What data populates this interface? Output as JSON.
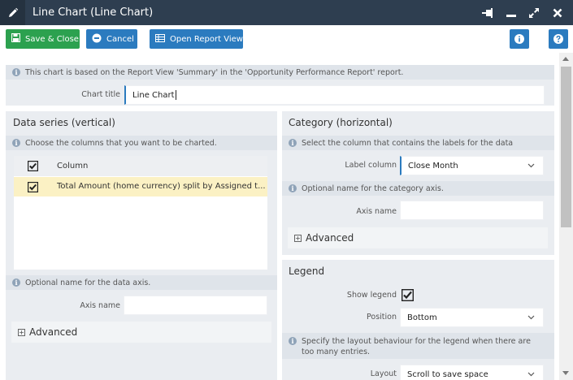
{
  "window": {
    "title": "Line Chart (Line Chart)",
    "icons": [
      "pencil-icon",
      "pin-icon",
      "minimize-icon",
      "maximize-icon",
      "close-icon"
    ]
  },
  "toolbar": {
    "save_close": "Save & Close",
    "cancel": "Cancel",
    "open_report_view": "Open Report View",
    "info_icon": "info-icon",
    "help_icon": "help-icon"
  },
  "intro": {
    "info": "This chart is based on the Report View 'Summary' in the 'Opportunity Performance Report' report.",
    "chart_title_label": "Chart title",
    "chart_title_value": "Line Chart"
  },
  "data_series": {
    "heading": "Data series (vertical)",
    "info": "Choose the columns that you want to be charted.",
    "column_header": "Column",
    "rows": [
      {
        "label": "Total Amount (home currency) split by Assigned t...",
        "checked": true
      }
    ],
    "axis_info": "Optional name for the data axis.",
    "axis_name_label": "Axis name",
    "axis_name_value": "",
    "advanced": "Advanced"
  },
  "category": {
    "heading": "Category (horizontal)",
    "info": "Select the column that contains the labels for the data",
    "label_column_label": "Label column",
    "label_column_value": "Close Month",
    "axis_info": "Optional name for the category axis.",
    "axis_name_label": "Axis name",
    "axis_name_value": "",
    "advanced": "Advanced"
  },
  "legend": {
    "heading": "Legend",
    "show_legend_label": "Show legend",
    "show_legend_checked": true,
    "position_label": "Position",
    "position_value": "Bottom",
    "layout_info": "Specify the layout behaviour for the legend when there are too many entries.",
    "layout_label": "Layout",
    "layout_value": "Scroll to save space"
  },
  "colors": {
    "titlebar": "#2e3e50",
    "green": "#2ca14f",
    "blue": "#2b7bbf",
    "selected_row": "#fbf1c4"
  }
}
